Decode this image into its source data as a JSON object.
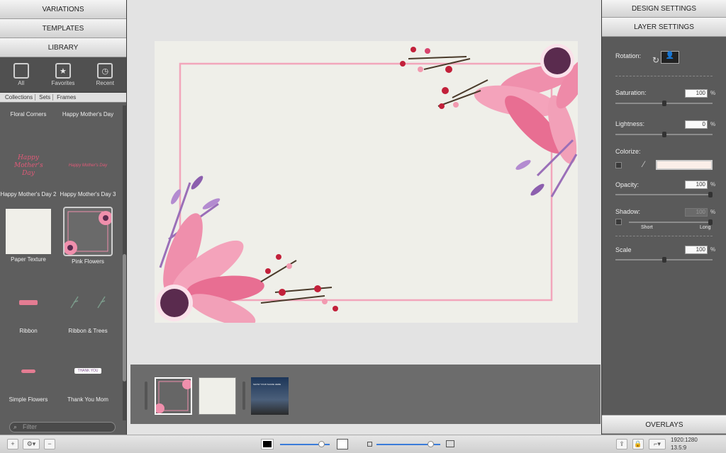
{
  "left": {
    "variations": "VARIATIONS",
    "templates": "TEMPLATES",
    "library": "LIBRARY",
    "filters": [
      {
        "label": "All",
        "icon": "square-icon"
      },
      {
        "label": "Favorites",
        "icon": "star-icon"
      },
      {
        "label": "Recent",
        "icon": "clock-icon"
      }
    ],
    "breadcrumb": [
      "Collections",
      "Sets",
      "Frames"
    ],
    "items": [
      "Floral Corners",
      "Happy Mother's Day",
      "Happy Mother's Day 2",
      "Happy Mother's Day 3",
      "Paper Texture",
      "Pink Flowers",
      "Ribbon",
      "Ribbon & Trees",
      "Simple Flowers",
      "Thank You Mom"
    ],
    "thumb_text": {
      "hmd2": "Happy Mother's Day",
      "hmd3": "Happy Mother's Day",
      "tym": "THANK YOU"
    },
    "filter_placeholder": "Filter"
  },
  "right": {
    "design": "DESIGN SETTINGS",
    "layer": "LAYER SETTINGS",
    "overlays": "OVERLAYS",
    "rotation": "Rotation:",
    "saturation": "Saturation:",
    "saturation_val": "100",
    "lightness": "Lightness:",
    "lightness_val": "0",
    "colorize": "Colorize:",
    "colorize_color": "#fbefe9",
    "opacity": "Opacity:",
    "opacity_val": "100",
    "shadow": "Shadow:",
    "shadow_val": "100",
    "short": "Short",
    "long": "Long",
    "scale": "Scale",
    "scale_val": "100",
    "pct": "%"
  },
  "status": {
    "res": "1920:1280",
    "ratio": "13.5:9"
  },
  "film": {
    "thumb3_text": "SHOW YOUR SHADE HERE"
  },
  "colors": {
    "pink": "#ef8fac",
    "deep": "#d8446e",
    "purple": "#9a6fb8",
    "center": "#5a2b4e",
    "berry": "#c2203a"
  }
}
